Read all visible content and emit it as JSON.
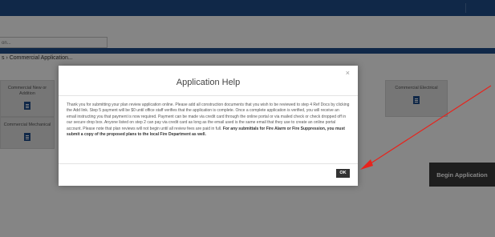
{
  "page": {
    "search_value": "on...",
    "breadcrumb": "s › Commercial Application...",
    "cards": [
      {
        "label": "Commercial New or Addition"
      },
      {
        "label": "Commercial Mechanical"
      },
      {
        "label": "Commercial Electrical"
      }
    ],
    "begin_label": "Begin Application"
  },
  "modal": {
    "close_glyph": "×",
    "title": "Application Help",
    "body": "Thank you for submitting your plan review application online. Please add all construction documents that you wish to be reviewed to step 4 Ref Docs by clicking the Add link. Step 5 payment will be $0 until office staff verifies that the application is complete. Once a complete application is verified, you will receive an email instructing you that payment is now required. Payment can be made via credit card through the online portal or via mailed check or check dropped off in our secure drop box. Anyone listed on step 2 can pay via credit card as long as the email used is the same email that they use to create an online portal account. Please note that plan reviews will not begin until all review fees are paid in full.",
    "body_bold": "For any submittals for Fire Alarm or Fire Suppression, you must submit a copy of the proposed plans to the local Fire Department as well.",
    "ok_label": "OK"
  },
  "colors": {
    "brand": "#1f4e8a",
    "annotation_arrow": "#e8231c"
  }
}
